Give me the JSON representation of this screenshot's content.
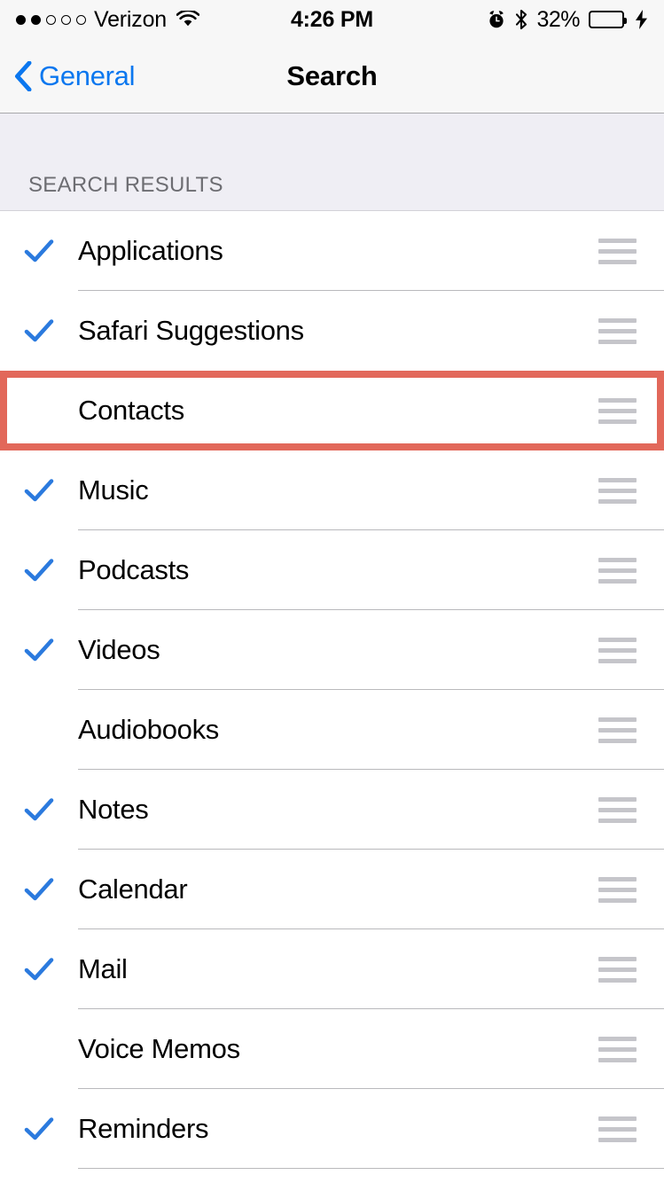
{
  "status_bar": {
    "signal_dots_filled": 2,
    "signal_dots_total": 5,
    "carrier": "Verizon",
    "wifi_icon": "wifi-icon",
    "time": "4:26 PM",
    "alarm_icon": "alarm-clock-icon",
    "bluetooth_icon": "bluetooth-icon",
    "battery_percent": "32%",
    "battery_level": 32,
    "battery_color": "#4cd964",
    "charging_icon": "lightning-bolt-icon"
  },
  "nav_bar": {
    "back_icon": "chevron-left-icon",
    "back_label": "General",
    "title": "Search",
    "accent_color": "#0b77ef"
  },
  "section": {
    "header": "SEARCH RESULTS"
  },
  "highlight": {
    "color": "#e2685a",
    "target_row": "Contacts"
  },
  "rows": [
    {
      "label": "Applications",
      "checked": true,
      "grip_icon": "reorder-grip-icon",
      "highlighted": false
    },
    {
      "label": "Safari Suggestions",
      "checked": true,
      "grip_icon": "reorder-grip-icon",
      "highlighted": false
    },
    {
      "label": "Contacts",
      "checked": false,
      "grip_icon": "reorder-grip-icon",
      "highlighted": true
    },
    {
      "label": "Music",
      "checked": true,
      "grip_icon": "reorder-grip-icon",
      "highlighted": false
    },
    {
      "label": "Podcasts",
      "checked": true,
      "grip_icon": "reorder-grip-icon",
      "highlighted": false
    },
    {
      "label": "Videos",
      "checked": true,
      "grip_icon": "reorder-grip-icon",
      "highlighted": false
    },
    {
      "label": "Audiobooks",
      "checked": false,
      "grip_icon": "reorder-grip-icon",
      "highlighted": false
    },
    {
      "label": "Notes",
      "checked": true,
      "grip_icon": "reorder-grip-icon",
      "highlighted": false
    },
    {
      "label": "Calendar",
      "checked": true,
      "grip_icon": "reorder-grip-icon",
      "highlighted": false
    },
    {
      "label": "Mail",
      "checked": true,
      "grip_icon": "reorder-grip-icon",
      "highlighted": false
    },
    {
      "label": "Voice Memos",
      "checked": false,
      "grip_icon": "reorder-grip-icon",
      "highlighted": false
    },
    {
      "label": "Reminders",
      "checked": true,
      "grip_icon": "reorder-grip-icon",
      "highlighted": false
    }
  ]
}
